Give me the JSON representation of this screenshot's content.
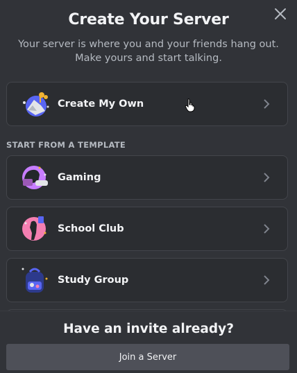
{
  "modal": {
    "title": "Create Your Server",
    "subtitle": "Your server is where you and your friends hang out. Make yours and start talking."
  },
  "options": {
    "create_own": {
      "label": "Create My Own",
      "icon": "create-own-art"
    },
    "section_heading": "START FROM A TEMPLATE",
    "templates": [
      {
        "label": "Gaming",
        "icon": "gaming-art"
      },
      {
        "label": "School Club",
        "icon": "school-club-art"
      },
      {
        "label": "Study Group",
        "icon": "study-group-art"
      }
    ]
  },
  "footer": {
    "invite_heading": "Have an invite already?",
    "join_label": "Join a Server"
  },
  "colors": {
    "background": "#313338",
    "card": "#2b2d31",
    "card_border": "#43454b",
    "button": "#4e5058",
    "muted_text": "#b5bac1"
  }
}
